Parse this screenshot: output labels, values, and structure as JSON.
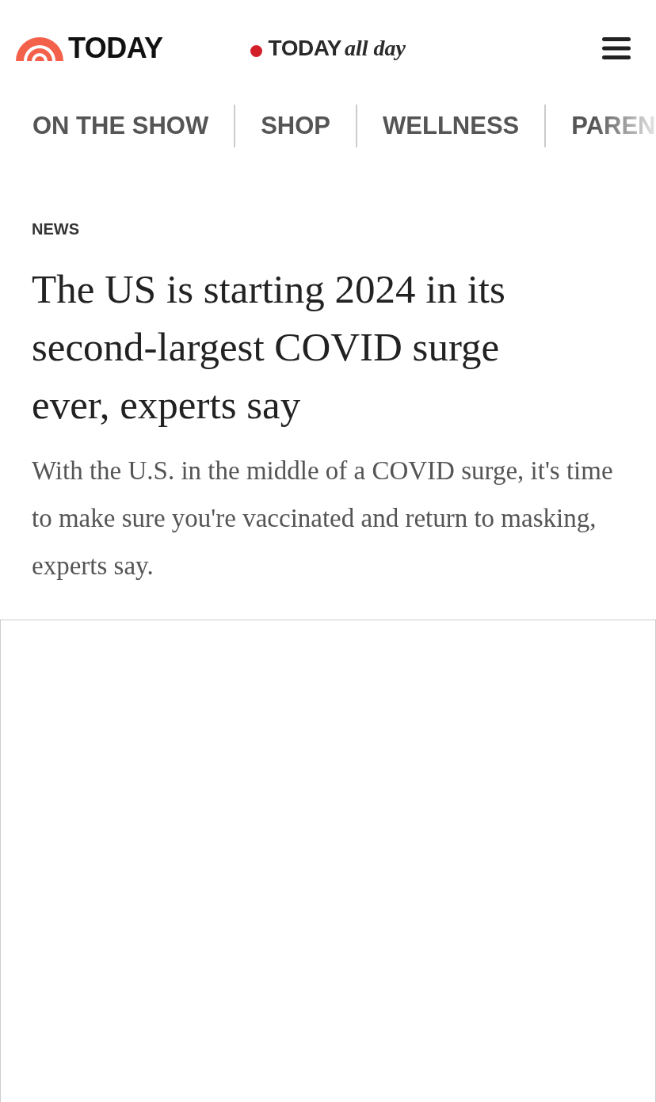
{
  "header": {
    "logo": "TODAY",
    "live_brand": "TODAY",
    "live_suffix": "all day"
  },
  "nav": [
    {
      "label": "ON THE SHOW"
    },
    {
      "label": "SHOP"
    },
    {
      "label": "WELLNESS"
    },
    {
      "label": "PAREN"
    }
  ],
  "article": {
    "section": "NEWS",
    "headline": "The US is starting 2024 in its second-largest COVID surge ever, experts say",
    "dek": "With the U.S. in the middle of a COVID surge, it's time to make sure you're vaccinated and return to masking, experts say."
  }
}
